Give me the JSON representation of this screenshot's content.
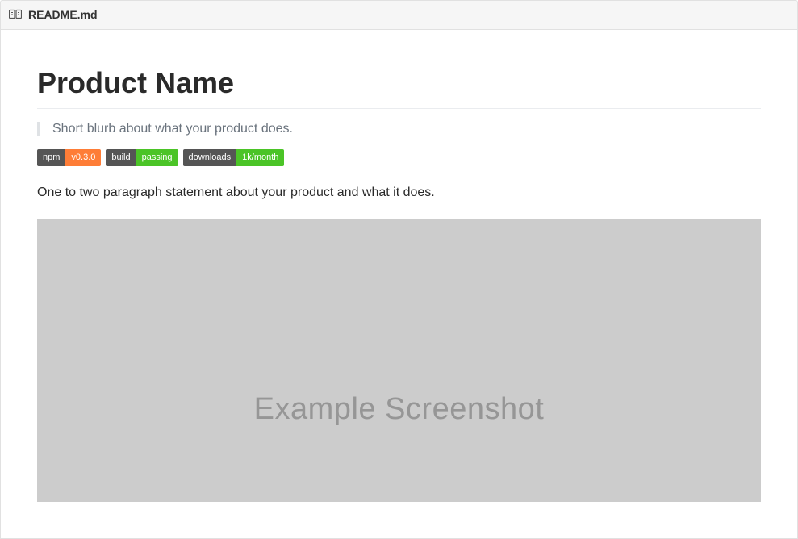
{
  "header": {
    "filename": "README.md"
  },
  "title": "Product Name",
  "blurb": "Short blurb about what your product does.",
  "badges": {
    "npm": {
      "label": "npm",
      "value": "v0.3.0"
    },
    "build": {
      "label": "build",
      "value": "passing"
    },
    "downloads": {
      "label": "downloads",
      "value": "1k/month"
    }
  },
  "description": "One to two paragraph statement about your product and what it does.",
  "screenshot_label": "Example Screenshot"
}
